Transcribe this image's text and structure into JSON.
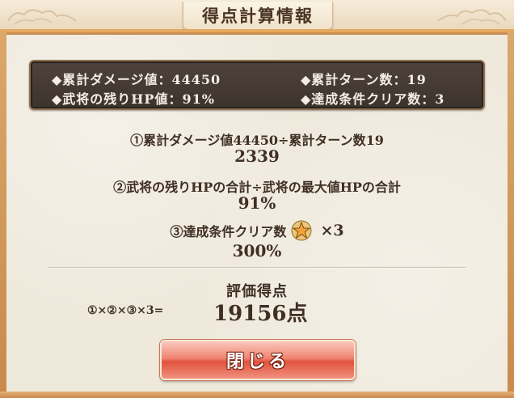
{
  "header": {
    "title": "得点計算情報"
  },
  "stats": {
    "damage": "◆累計ダメージ値：44450",
    "turns": "◆累計ターン数：19",
    "hp": "◆武将の残りHP値：91%",
    "conditions": "◆達成条件クリア数：3"
  },
  "calc": {
    "f1_formula": "①累計ダメージ値44450÷累計ターン数19",
    "f1_value": "2339",
    "f2_formula": "②武将の残りHPの合計÷武将の最大値HPの合計",
    "f2_value": "91%",
    "f3_label": "③達成条件クリア数",
    "f3_multiplier": "×3",
    "f3_value": "300%",
    "star_icon": "gold-star-icon"
  },
  "result": {
    "label": "評価得点",
    "expression": "①×②×③×3=",
    "score": "19156点"
  },
  "buttons": {
    "close": "閉じる"
  },
  "colors": {
    "button_red": "#e0533e",
    "frame_gold": "#c98a4a",
    "panel_dark": "#3d332d",
    "text_brown": "#3f2f24"
  }
}
